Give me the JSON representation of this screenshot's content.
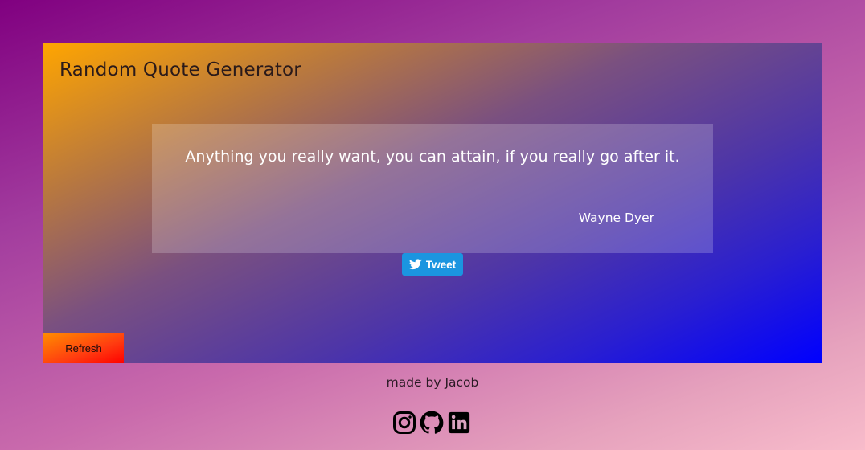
{
  "app": {
    "title": "Random Quote Generator"
  },
  "quote": {
    "text": "Anything you really want, you can attain, if you really go after it.",
    "author": "Wayne Dyer"
  },
  "tweet_button": {
    "label": "Tweet",
    "icon": "twitter-bird-icon"
  },
  "refresh_button": {
    "label": "Refresh"
  },
  "footer": {
    "credit": "made by Jacob",
    "social_icons": [
      "instagram-icon",
      "github-icon",
      "linkedin-icon"
    ]
  },
  "colors": {
    "page_gradient": [
      "#800080",
      "#f8bccb"
    ],
    "card_gradient": [
      "#ffa500",
      "#0000ff"
    ],
    "tweet_button": "#1b95e0",
    "refresh_gradient": [
      "#ff8c00",
      "#ff0000"
    ],
    "quote_text": "#ffffff"
  }
}
